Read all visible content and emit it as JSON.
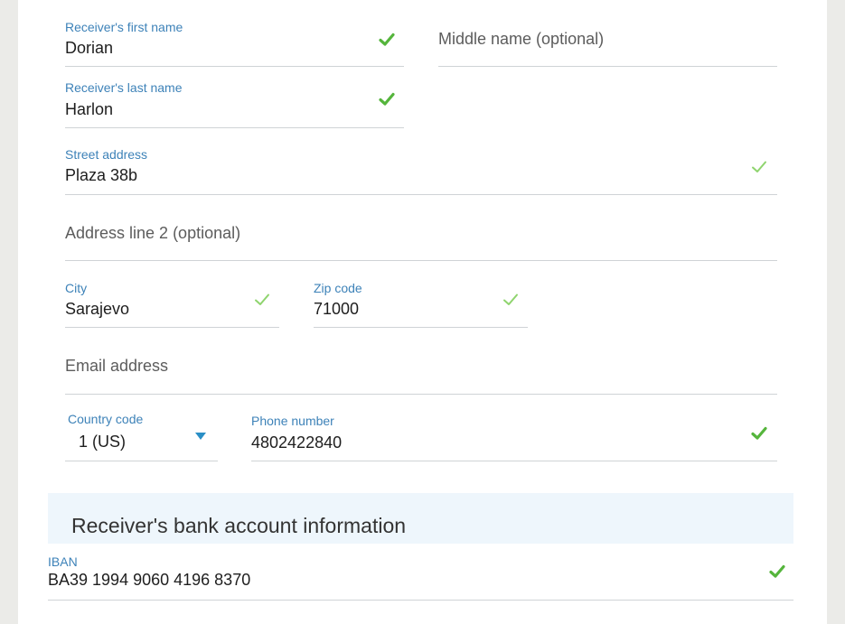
{
  "form": {
    "first_name": {
      "label": "Receiver's first name",
      "value": "Dorian"
    },
    "middle_name": {
      "placeholder": "Middle name (optional)"
    },
    "last_name": {
      "label": "Receiver's last name",
      "value": "Harlon"
    },
    "street": {
      "label": "Street address",
      "value": "Plaza 38b"
    },
    "address2": {
      "placeholder": "Address line 2 (optional)"
    },
    "city": {
      "label": "City",
      "value": "Sarajevo"
    },
    "zip": {
      "label": "Zip code",
      "value": "71000"
    },
    "email": {
      "placeholder": "Email address"
    },
    "country_code": {
      "label": "Country code",
      "value": "1 (US)"
    },
    "phone": {
      "label": "Phone number",
      "value": "4802422840"
    }
  },
  "bank_section": {
    "title": "Receiver's bank account information",
    "iban": {
      "label": "IBAN",
      "value": "BA39 1994 9060 4196 8370"
    }
  },
  "icons": {
    "valid": "check-icon",
    "dropdown": "caret-down-icon"
  },
  "colors": {
    "label": "#3d82b8",
    "check_bold": "#55b53c",
    "check_light": "#8fd46e",
    "caret": "#2a8fc6",
    "section_bg": "#eef6fc"
  }
}
